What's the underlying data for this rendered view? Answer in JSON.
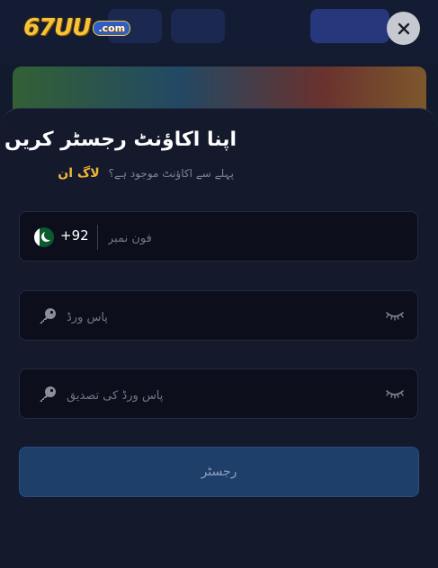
{
  "header": {
    "logo_text": "67UU",
    "logo_suffix": ".com"
  },
  "modal": {
    "title": "اپنا اکاؤنٹ رجسٹر کریں",
    "already_have_account": "پہلے سے اکاؤنٹ موجود ہے؟",
    "login_link": "لاگ ان",
    "phone": {
      "country_code": "+92",
      "flag": "pakistan-flag",
      "placeholder": "فون نمبر",
      "value": ""
    },
    "password": {
      "placeholder": "پاس ورڈ",
      "value": ""
    },
    "confirm_password": {
      "placeholder": "پاس ورڈ کی تصدیق",
      "value": ""
    },
    "register_button": "رجسٹر"
  },
  "colors": {
    "accent_gold": "#f2b533",
    "sheet_bg": "#141a2c",
    "button_bg": "#1f3f6b"
  },
  "icons": [
    "close-icon",
    "pakistan-flag-icon",
    "key-icon",
    "eye-hidden-icon"
  ]
}
